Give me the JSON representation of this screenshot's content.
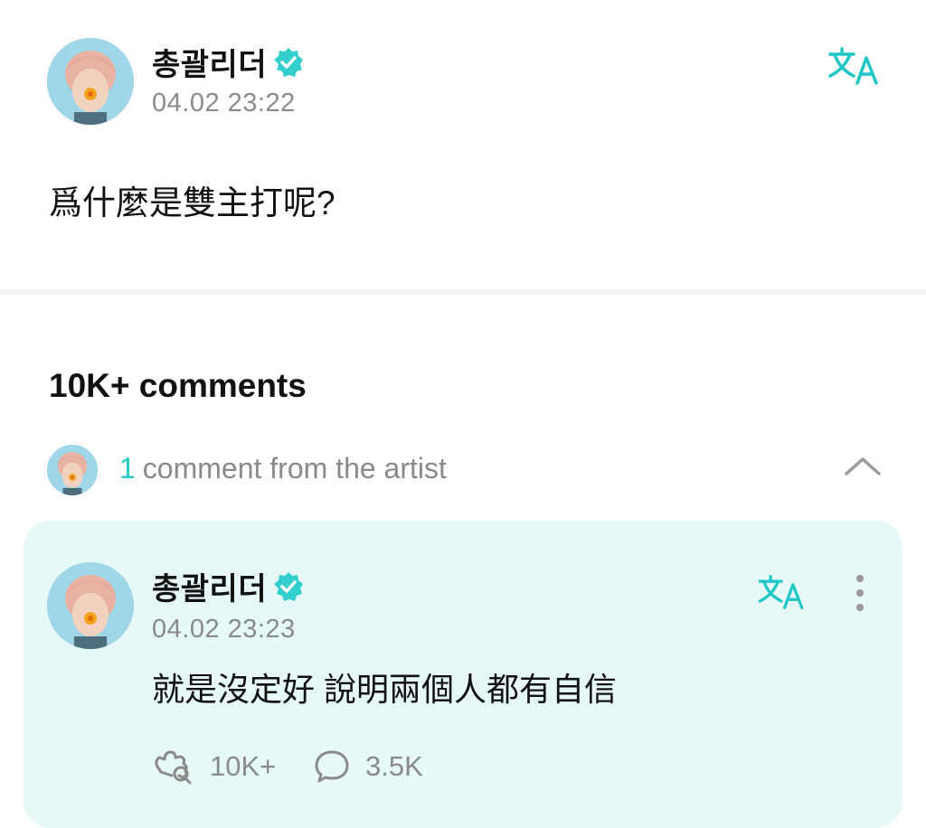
{
  "post": {
    "author": "총괄리더",
    "verified_icon": "verified-badge-icon",
    "timestamp": "04.02 23:22",
    "text": "爲什麼是雙主打呢?",
    "translate_icon": "translate-icon"
  },
  "comments_section": {
    "title": "10K+ comments",
    "artist_row": {
      "count": "1",
      "label": "comment from the artist",
      "chevron_icon": "chevron-up-icon"
    }
  },
  "artist_comment": {
    "author": "총괄리더",
    "timestamp": "04.02 23:23",
    "text": "就是沒定好 說明兩個人都有自信",
    "likes": "10K+",
    "replies": "3.5K",
    "translate_icon": "translate-icon",
    "more_icon": "more-vertical-icon"
  },
  "colors": {
    "accent": "#1fc6c6",
    "card_background": "#e6f8f7",
    "muted_text": "#8a8a8a"
  }
}
